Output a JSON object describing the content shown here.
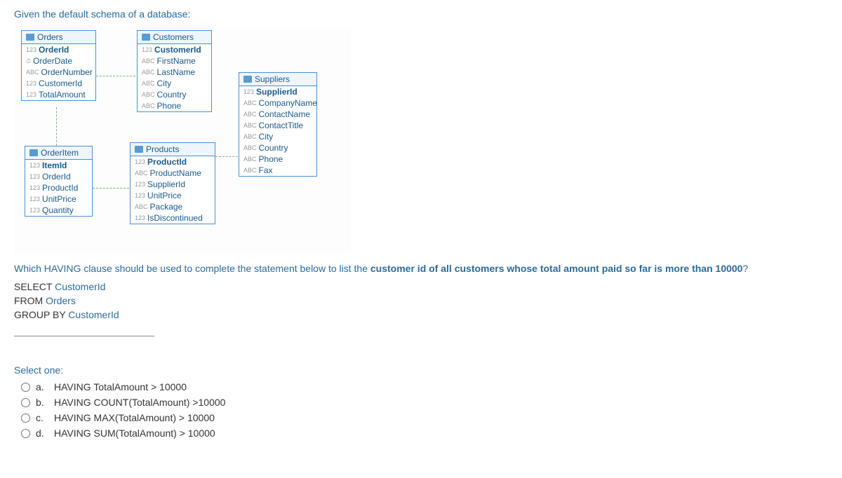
{
  "intro": "Given the default schema of a database:",
  "tables": {
    "orders": {
      "name": "Orders",
      "fields": [
        {
          "type": "123",
          "name": "OrderId",
          "bold": true
        },
        {
          "type": "⏱",
          "name": "OrderDate"
        },
        {
          "type": "ABC",
          "name": "OrderNumber"
        },
        {
          "type": "123",
          "name": "CustomerId"
        },
        {
          "type": "123",
          "name": "TotalAmount"
        }
      ]
    },
    "customers": {
      "name": "Customers",
      "fields": [
        {
          "type": "123",
          "name": "CustomerId",
          "bold": true
        },
        {
          "type": "ABC",
          "name": "FirstName"
        },
        {
          "type": "ABC",
          "name": "LastName"
        },
        {
          "type": "ABC",
          "name": "City"
        },
        {
          "type": "ABC",
          "name": "Country"
        },
        {
          "type": "ABC",
          "name": "Phone"
        }
      ]
    },
    "suppliers": {
      "name": "Suppliers",
      "fields": [
        {
          "type": "123",
          "name": "SupplierId",
          "bold": true
        },
        {
          "type": "ABC",
          "name": "CompanyName"
        },
        {
          "type": "ABC",
          "name": "ContactName"
        },
        {
          "type": "ABC",
          "name": "ContactTitle"
        },
        {
          "type": "ABC",
          "name": "City"
        },
        {
          "type": "ABC",
          "name": "Country"
        },
        {
          "type": "ABC",
          "name": "Phone"
        },
        {
          "type": "ABC",
          "name": "Fax"
        }
      ]
    },
    "orderitem": {
      "name": "OrderItem",
      "fields": [
        {
          "type": "123",
          "name": "ItemId",
          "bold": true
        },
        {
          "type": "123",
          "name": "OrderId"
        },
        {
          "type": "123",
          "name": "ProductId"
        },
        {
          "type": "123",
          "name": "UnitPrice"
        },
        {
          "type": "123",
          "name": "Quantity"
        }
      ]
    },
    "products": {
      "name": "Products",
      "fields": [
        {
          "type": "123",
          "name": "ProductId",
          "bold": true
        },
        {
          "type": "ABC",
          "name": "ProductName"
        },
        {
          "type": "123",
          "name": "SupplierId"
        },
        {
          "type": "123",
          "name": "UnitPrice"
        },
        {
          "type": "ABC",
          "name": "Package"
        },
        {
          "type": "123",
          "name": "IsDiscontinued"
        }
      ]
    }
  },
  "question": {
    "prefix": "Which HAVING clause should be used to complete the statement below to list the ",
    "emph": "customer id of all customers whose total amount paid so far is more than 10000",
    "suffix": "?"
  },
  "sql": {
    "line1_kw": "SELECT",
    "line1_col": " CustomerId",
    "line2_kw": "FROM",
    "line2_col": " Orders",
    "line3_kw": "GROUP BY",
    "line3_col": " CustomerId"
  },
  "select_one": "Select one:",
  "options": [
    {
      "letter": "a.",
      "text": "HAVING TotalAmount > 10000",
      "func_start": 7,
      "func_end": 7
    },
    {
      "letter": "b.",
      "text": "HAVING COUNT(TotalAmount) >10000",
      "func": "COUNT"
    },
    {
      "letter": "c.",
      "text": "HAVING MAX(TotalAmount) > 10000",
      "func": "MAX"
    },
    {
      "letter": "d.",
      "text": "HAVING SUM(TotalAmount) > 10000",
      "func": "SUM"
    }
  ]
}
